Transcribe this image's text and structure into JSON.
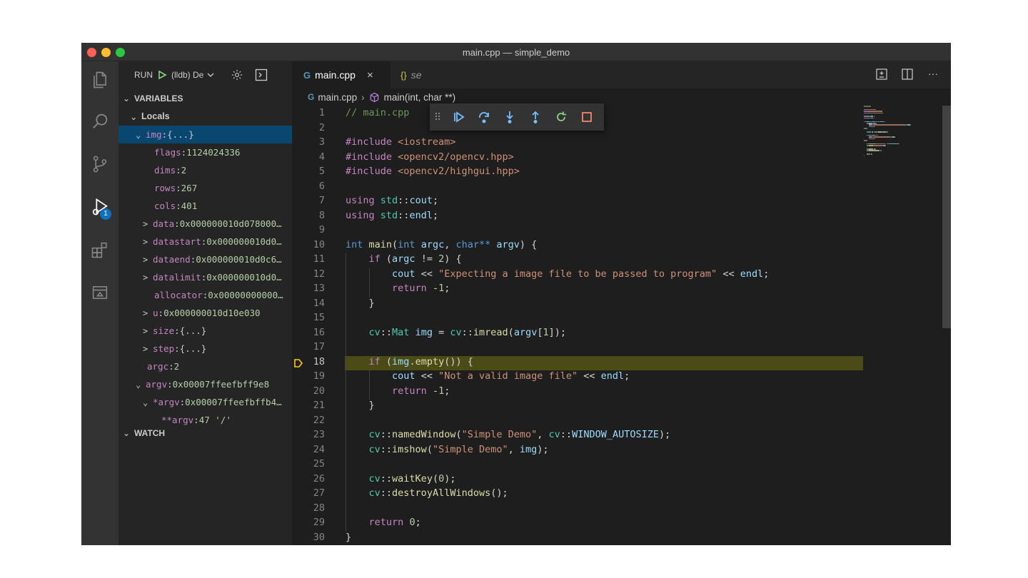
{
  "window": {
    "title": "main.cpp — simple_demo"
  },
  "colors": {
    "red": "#ff5f57",
    "yellow": "#febc2e",
    "green": "#28c840",
    "accent": "#0e70c0",
    "highlight": "#4b4b18",
    "selection": "#094771"
  },
  "activity_bar": {
    "items": [
      {
        "name": "explorer-icon"
      },
      {
        "name": "search-icon"
      },
      {
        "name": "source-control-icon"
      },
      {
        "name": "run-debug-icon",
        "badge": "1"
      },
      {
        "name": "extensions-icon"
      },
      {
        "name": "remote-explorer-icon"
      }
    ]
  },
  "sidebar": {
    "run_label": "RUN",
    "config_label": "(lldb) De",
    "variables_header": "VARIABLES",
    "locals_header": "Locals",
    "watch_header": "WATCH",
    "variables": [
      {
        "twisty": "⌄",
        "name": "img",
        "value": "{...}",
        "kind": "obj",
        "selected": true
      },
      {
        "twisty": "",
        "name": "flags",
        "value": "1124024336",
        "kind": "num"
      },
      {
        "twisty": "",
        "name": "dims",
        "value": "2",
        "kind": "num"
      },
      {
        "twisty": "",
        "name": "rows",
        "value": "267",
        "kind": "num"
      },
      {
        "twisty": "",
        "name": "cols",
        "value": "401",
        "kind": "num"
      },
      {
        "twisty": ">",
        "name": "data",
        "value": "0x000000010d078000…",
        "kind": "num"
      },
      {
        "twisty": ">",
        "name": "datastart",
        "value": "0x000000010d0…",
        "kind": "num"
      },
      {
        "twisty": ">",
        "name": "dataend",
        "value": "0x000000010d0c6…",
        "kind": "num"
      },
      {
        "twisty": ">",
        "name": "datalimit",
        "value": "0x000000010d0…",
        "kind": "num"
      },
      {
        "twisty": "",
        "name": "allocator",
        "value": "0x00000000000…",
        "kind": "num"
      },
      {
        "twisty": ">",
        "name": "u",
        "value": "0x000000010d10e030",
        "kind": "num"
      },
      {
        "twisty": ">",
        "name": "size",
        "value": "{...}",
        "kind": "obj"
      },
      {
        "twisty": ">",
        "name": "step",
        "value": "{...}",
        "kind": "obj"
      },
      {
        "twisty": "",
        "name": "argc",
        "value": "2",
        "kind": "num"
      },
      {
        "twisty": "⌄",
        "name": "argv",
        "value": "0x00007ffeefbff9e8",
        "kind": "num"
      },
      {
        "twisty": "⌄",
        "name": "*argv",
        "value": "0x00007ffeefbffb4…",
        "kind": "num"
      },
      {
        "twisty": "",
        "name": "**argv",
        "value": "47 '/'",
        "kind": "num"
      }
    ]
  },
  "editor": {
    "tabs": [
      {
        "label": "main.cpp",
        "active": true
      },
      {
        "label": "se",
        "active": false
      }
    ],
    "breadcrumb": {
      "file": "main.cpp",
      "symbol": "main(int, char **)"
    },
    "current_line": 18,
    "lines": [
      {
        "n": "1",
        "tokens": [
          {
            "t": "// main.cpp",
            "c": "comment"
          }
        ]
      },
      {
        "n": "2",
        "tokens": []
      },
      {
        "n": "3",
        "tokens": [
          {
            "t": "#include ",
            "c": "dir"
          },
          {
            "t": "<iostream>",
            "c": "str"
          }
        ]
      },
      {
        "n": "4",
        "tokens": [
          {
            "t": "#include ",
            "c": "dir"
          },
          {
            "t": "<opencv2/opencv.hpp>",
            "c": "str"
          }
        ]
      },
      {
        "n": "5",
        "tokens": [
          {
            "t": "#include ",
            "c": "dir"
          },
          {
            "t": "<opencv2/highgui.hpp>",
            "c": "str"
          }
        ]
      },
      {
        "n": "6",
        "tokens": []
      },
      {
        "n": "7",
        "tokens": [
          {
            "t": "using ",
            "c": "ctrl"
          },
          {
            "t": "std",
            "c": "ns"
          },
          {
            "t": "::",
            "c": "op"
          },
          {
            "t": "cout",
            "c": "var"
          },
          {
            "t": ";",
            "c": "op"
          }
        ]
      },
      {
        "n": "8",
        "tokens": [
          {
            "t": "using ",
            "c": "ctrl"
          },
          {
            "t": "std",
            "c": "ns"
          },
          {
            "t": "::",
            "c": "op"
          },
          {
            "t": "endl",
            "c": "var"
          },
          {
            "t": ";",
            "c": "op"
          }
        ]
      },
      {
        "n": "9",
        "tokens": []
      },
      {
        "n": "10",
        "tokens": [
          {
            "t": "int ",
            "c": "kw"
          },
          {
            "t": "main",
            "c": "fn"
          },
          {
            "t": "(",
            "c": "op"
          },
          {
            "t": "int ",
            "c": "kw"
          },
          {
            "t": "argc",
            "c": "var"
          },
          {
            "t": ", ",
            "c": "op"
          },
          {
            "t": "char",
            "c": "kw"
          },
          {
            "t": "** ",
            "c": "kw"
          },
          {
            "t": "argv",
            "c": "var"
          },
          {
            "t": ") {",
            "c": "op"
          }
        ]
      },
      {
        "n": "11",
        "tokens": [
          {
            "t": "    ",
            "c": "op"
          },
          {
            "t": "if",
            "c": "ctrl"
          },
          {
            "t": " (",
            "c": "op"
          },
          {
            "t": "argc",
            "c": "var"
          },
          {
            "t": " != ",
            "c": "op"
          },
          {
            "t": "2",
            "c": "num"
          },
          {
            "t": ") {",
            "c": "op"
          }
        ]
      },
      {
        "n": "12",
        "tokens": [
          {
            "t": "        ",
            "c": "op"
          },
          {
            "t": "cout",
            "c": "var"
          },
          {
            "t": " << ",
            "c": "op"
          },
          {
            "t": "\"Expecting a image file to be passed to program\"",
            "c": "str"
          },
          {
            "t": " << ",
            "c": "op"
          },
          {
            "t": "endl",
            "c": "var"
          },
          {
            "t": ";",
            "c": "op"
          }
        ]
      },
      {
        "n": "13",
        "tokens": [
          {
            "t": "        ",
            "c": "op"
          },
          {
            "t": "return",
            "c": "ctrl"
          },
          {
            "t": " -",
            "c": "op"
          },
          {
            "t": "1",
            "c": "num"
          },
          {
            "t": ";",
            "c": "op"
          }
        ]
      },
      {
        "n": "14",
        "tokens": [
          {
            "t": "    }",
            "c": "op"
          }
        ]
      },
      {
        "n": "15",
        "tokens": []
      },
      {
        "n": "16",
        "tokens": [
          {
            "t": "    ",
            "c": "op"
          },
          {
            "t": "cv",
            "c": "ns"
          },
          {
            "t": "::",
            "c": "op"
          },
          {
            "t": "Mat",
            "c": "type"
          },
          {
            "t": " ",
            "c": "op"
          },
          {
            "t": "img",
            "c": "var"
          },
          {
            "t": " = ",
            "c": "op"
          },
          {
            "t": "cv",
            "c": "ns"
          },
          {
            "t": "::",
            "c": "op"
          },
          {
            "t": "imread",
            "c": "fn"
          },
          {
            "t": "(",
            "c": "op"
          },
          {
            "t": "argv",
            "c": "var"
          },
          {
            "t": "[",
            "c": "op"
          },
          {
            "t": "1",
            "c": "num"
          },
          {
            "t": "]);",
            "c": "op"
          }
        ]
      },
      {
        "n": "17",
        "tokens": []
      },
      {
        "n": "18",
        "tokens": [
          {
            "t": "    ",
            "c": "op"
          },
          {
            "t": "if",
            "c": "ctrl"
          },
          {
            "t": " (",
            "c": "op"
          },
          {
            "t": "img",
            "c": "var"
          },
          {
            "t": ".",
            "c": "op"
          },
          {
            "t": "empty",
            "c": "fn"
          },
          {
            "t": "()) {",
            "c": "op"
          }
        ]
      },
      {
        "n": "19",
        "tokens": [
          {
            "t": "        ",
            "c": "op"
          },
          {
            "t": "cout",
            "c": "var"
          },
          {
            "t": " << ",
            "c": "op"
          },
          {
            "t": "\"Not a valid image file\"",
            "c": "str"
          },
          {
            "t": " << ",
            "c": "op"
          },
          {
            "t": "endl",
            "c": "var"
          },
          {
            "t": ";",
            "c": "op"
          }
        ]
      },
      {
        "n": "20",
        "tokens": [
          {
            "t": "        ",
            "c": "op"
          },
          {
            "t": "return",
            "c": "ctrl"
          },
          {
            "t": " -",
            "c": "op"
          },
          {
            "t": "1",
            "c": "num"
          },
          {
            "t": ";",
            "c": "op"
          }
        ]
      },
      {
        "n": "21",
        "tokens": [
          {
            "t": "    }",
            "c": "op"
          }
        ]
      },
      {
        "n": "22",
        "tokens": []
      },
      {
        "n": "23",
        "tokens": [
          {
            "t": "    ",
            "c": "op"
          },
          {
            "t": "cv",
            "c": "ns"
          },
          {
            "t": "::",
            "c": "op"
          },
          {
            "t": "namedWindow",
            "c": "fn"
          },
          {
            "t": "(",
            "c": "op"
          },
          {
            "t": "\"Simple Demo\"",
            "c": "str"
          },
          {
            "t": ", ",
            "c": "op"
          },
          {
            "t": "cv",
            "c": "ns"
          },
          {
            "t": "::",
            "c": "op"
          },
          {
            "t": "WINDOW_AUTOSIZE",
            "c": "var"
          },
          {
            "t": ");",
            "c": "op"
          }
        ]
      },
      {
        "n": "24",
        "tokens": [
          {
            "t": "    ",
            "c": "op"
          },
          {
            "t": "cv",
            "c": "ns"
          },
          {
            "t": "::",
            "c": "op"
          },
          {
            "t": "imshow",
            "c": "fn"
          },
          {
            "t": "(",
            "c": "op"
          },
          {
            "t": "\"Simple Demo\"",
            "c": "str"
          },
          {
            "t": ", ",
            "c": "op"
          },
          {
            "t": "img",
            "c": "var"
          },
          {
            "t": ");",
            "c": "op"
          }
        ]
      },
      {
        "n": "25",
        "tokens": []
      },
      {
        "n": "26",
        "tokens": [
          {
            "t": "    ",
            "c": "op"
          },
          {
            "t": "cv",
            "c": "ns"
          },
          {
            "t": "::",
            "c": "op"
          },
          {
            "t": "waitKey",
            "c": "fn"
          },
          {
            "t": "(",
            "c": "op"
          },
          {
            "t": "0",
            "c": "num"
          },
          {
            "t": ");",
            "c": "op"
          }
        ]
      },
      {
        "n": "27",
        "tokens": [
          {
            "t": "    ",
            "c": "op"
          },
          {
            "t": "cv",
            "c": "ns"
          },
          {
            "t": "::",
            "c": "op"
          },
          {
            "t": "destroyAllWindows",
            "c": "fn"
          },
          {
            "t": "();",
            "c": "op"
          }
        ]
      },
      {
        "n": "28",
        "tokens": []
      },
      {
        "n": "29",
        "tokens": [
          {
            "t": "    ",
            "c": "op"
          },
          {
            "t": "return",
            "c": "ctrl"
          },
          {
            "t": " ",
            "c": "op"
          },
          {
            "t": "0",
            "c": "num"
          },
          {
            "t": ";",
            "c": "op"
          }
        ]
      },
      {
        "n": "30",
        "tokens": [
          {
            "t": "}",
            "c": "op"
          }
        ]
      }
    ]
  },
  "debug_toolbar": {
    "buttons": [
      {
        "name": "continue-icon"
      },
      {
        "name": "step-over-icon"
      },
      {
        "name": "step-into-icon"
      },
      {
        "name": "step-out-icon"
      },
      {
        "name": "restart-icon"
      },
      {
        "name": "stop-icon"
      }
    ]
  },
  "editor_actions": [
    {
      "name": "open-changes-icon"
    },
    {
      "name": "split-editor-icon"
    },
    {
      "name": "more-actions-icon"
    }
  ]
}
